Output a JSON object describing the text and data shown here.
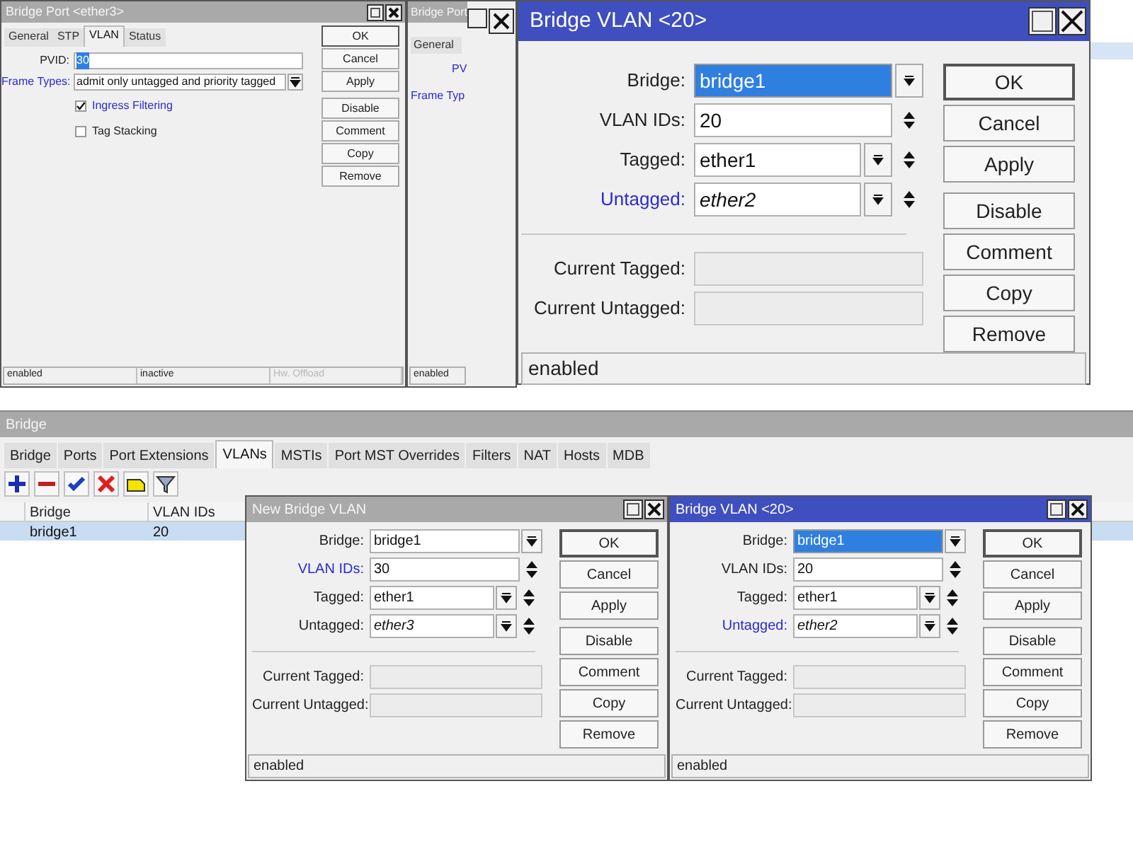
{
  "port_window": {
    "title": "Bridge Port <ether3>",
    "active": false,
    "tabs": [
      {
        "label": "General",
        "selected": false
      },
      {
        "label": "STP",
        "selected": false
      },
      {
        "label": "VLAN",
        "selected": true
      },
      {
        "label": "Status",
        "selected": false
      }
    ],
    "fields": [
      {
        "label": "PVID:",
        "value": "30",
        "label_highlighted": false,
        "value_selected": true,
        "kind": "text"
      },
      {
        "label": "Frame Types:",
        "value": "admit only untagged and priority tagged",
        "label_highlighted": true,
        "value_selected": false,
        "kind": "dropdown"
      }
    ],
    "checkboxes": [
      {
        "label": "Ingress Filtering",
        "checked": true,
        "label_highlighted": true
      },
      {
        "label": "Tag Stacking",
        "checked": false,
        "label_highlighted": false
      }
    ],
    "buttons": [
      "OK",
      "Cancel",
      "Apply",
      "Disable",
      "Comment",
      "Copy",
      "Remove"
    ],
    "status": [
      {
        "text": "enabled",
        "disabled": false
      },
      {
        "text": "inactive",
        "disabled": false
      },
      {
        "text": "Hw. Offload",
        "disabled": true
      }
    ]
  },
  "port_window_behind": {
    "title": "Bridge Port",
    "tab": "General",
    "labels": [
      "PV",
      "Frame Typ"
    ],
    "status": "enabled"
  },
  "vlan_window_zoomed": {
    "title": "Bridge VLAN <20>",
    "active": true,
    "fields": [
      {
        "label": "Bridge:",
        "value": "bridge1",
        "kind": "dropdown",
        "label_highlighted": false,
        "value_selected": true,
        "italic": false
      },
      {
        "label": "VLAN IDs:",
        "value": "20",
        "kind": "spin",
        "label_highlighted": false,
        "value_selected": false,
        "italic": false
      },
      {
        "label": "Tagged:",
        "value": "ether1",
        "kind": "dropdown_spin",
        "label_highlighted": false,
        "value_selected": false,
        "italic": false
      },
      {
        "label": "Untagged:",
        "value": "ether2",
        "kind": "dropdown_spin",
        "label_highlighted": true,
        "value_selected": false,
        "italic": true
      },
      {
        "label": "Current Tagged:",
        "kind": "readonly",
        "label_highlighted": false
      },
      {
        "label": "Current Untagged:",
        "kind": "readonly",
        "label_highlighted": false
      }
    ],
    "buttons": [
      "OK",
      "Cancel",
      "Apply",
      "Disable",
      "Comment",
      "Copy",
      "Remove"
    ],
    "status": "enabled"
  },
  "bridge_window": {
    "title": "Bridge",
    "tabs": [
      {
        "label": "Bridge",
        "selected": false
      },
      {
        "label": "Ports",
        "selected": false
      },
      {
        "label": "Port Extensions",
        "selected": false
      },
      {
        "label": "VLANs",
        "selected": true
      },
      {
        "label": "MSTIs",
        "selected": false
      },
      {
        "label": "Port MST Overrides",
        "selected": false
      },
      {
        "label": "Filters",
        "selected": false
      },
      {
        "label": "NAT",
        "selected": false
      },
      {
        "label": "Hosts",
        "selected": false
      },
      {
        "label": "MDB",
        "selected": false
      }
    ],
    "table": {
      "columns": [
        "Bridge",
        "VLAN IDs"
      ],
      "rows": [
        {
          "cells": [
            "bridge1",
            "20"
          ],
          "selected": true
        }
      ]
    }
  },
  "new_vlan_window": {
    "title": "New Bridge VLAN",
    "active": false,
    "fields": [
      {
        "label": "Bridge:",
        "value": "bridge1",
        "kind": "dropdown",
        "label_highlighted": false,
        "value_selected": false,
        "italic": false
      },
      {
        "label": "VLAN IDs:",
        "value": "30",
        "kind": "spin",
        "label_highlighted": true,
        "value_selected": false,
        "italic": false
      },
      {
        "label": "Tagged:",
        "value": "ether1",
        "kind": "dropdown_spin",
        "label_highlighted": false,
        "value_selected": false,
        "italic": false
      },
      {
        "label": "Untagged:",
        "value": "ether3",
        "kind": "dropdown_spin",
        "label_highlighted": false,
        "value_selected": false,
        "italic": true
      },
      {
        "label": "Current Tagged:",
        "kind": "readonly",
        "label_highlighted": false
      },
      {
        "label": "Current Untagged:",
        "kind": "readonly",
        "label_highlighted": false
      }
    ],
    "buttons": [
      "OK",
      "Cancel",
      "Apply",
      "Disable",
      "Comment",
      "Copy",
      "Remove"
    ],
    "status": "enabled"
  },
  "vlan_window": {
    "title": "Bridge VLAN <20>",
    "active": true,
    "fields": [
      {
        "label": "Bridge:",
        "value": "bridge1",
        "kind": "dropdown",
        "label_highlighted": false,
        "value_selected": true,
        "italic": false
      },
      {
        "label": "VLAN IDs:",
        "value": "20",
        "kind": "spin",
        "label_highlighted": false,
        "value_selected": false,
        "italic": false
      },
      {
        "label": "Tagged:",
        "value": "ether1",
        "kind": "dropdown_spin",
        "label_highlighted": false,
        "value_selected": false,
        "italic": false
      },
      {
        "label": "Untagged:",
        "value": "ether2",
        "kind": "dropdown_spin",
        "label_highlighted": true,
        "value_selected": false,
        "italic": true
      },
      {
        "label": "Current Tagged:",
        "kind": "readonly",
        "label_highlighted": false
      },
      {
        "label": "Current Untagged:",
        "kind": "readonly",
        "label_highlighted": false
      }
    ],
    "buttons": [
      "OK",
      "Cancel",
      "Apply",
      "Disable",
      "Comment",
      "Copy",
      "Remove"
    ],
    "status": "enabled"
  }
}
